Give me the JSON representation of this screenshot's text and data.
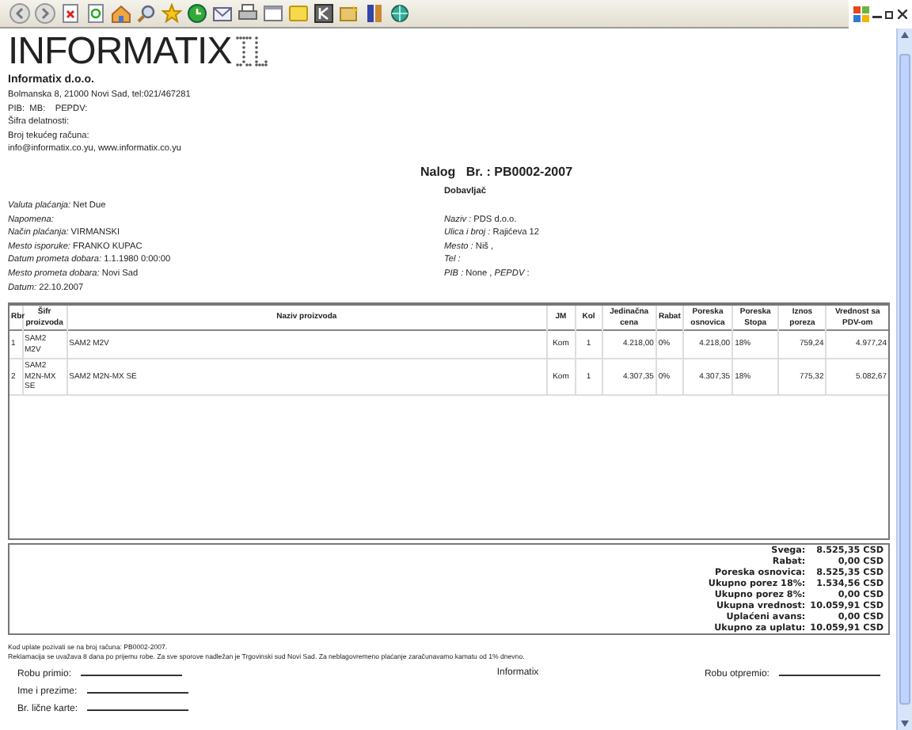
{
  "company": {
    "logo": "INFORMATIX",
    "name": "Informatix d.o.o.",
    "lines": [
      "Bolmanska 8, 21000 Novi Sad, tel:021/467281",
      "PIB:  MB:    PEPDV:",
      "Šifra delatnosti:",
      "Broj tekućeg računa:",
      "info@informatix.co.yu, www.informatix.co.yu"
    ]
  },
  "document_title": "Nalog   Br. : PB0002-2007",
  "payment_info": [
    {
      "label": "Valuta plaćanja:",
      "value": "Net Due"
    },
    {
      "label": "Napomena:"
    },
    {
      "label": "Način plaćanja:",
      "value": "VIRMANSKI"
    },
    {
      "label": "Mesto isporuke:",
      "value": "FRANKO KUPAC"
    },
    {
      "label": "Datum prometa dobara:",
      "value": "1.1.1980 0:00:00"
    },
    {
      "label": "Mesto prometa dobara:",
      "value": "Novi Sad"
    },
    {
      "label": "Datum:",
      "value": "22.10.2007"
    }
  ],
  "supplier": {
    "heading": "Dobavljač",
    "lines": [
      {
        "label": "Naziv :",
        "value": "PDS d.o.o."
      },
      {
        "label": "Ulica i broj :",
        "value": "Rajićeva 12"
      },
      {
        "label": "Mesto :",
        "value": "Niš ,"
      },
      {
        "label": "Tel :"
      },
      {
        "label": "PIB :",
        "value": "None , *PEPDV* :"
      }
    ]
  },
  "table": {
    "columns": [
      "Rbr",
      "Šifr proizvoda",
      "Naziv proizvoda",
      "JM",
      "Kol",
      "Jedinačna cena",
      "Rabat",
      "Poreska osnovica",
      "Poreska Stopa",
      "Iznos poreza",
      "Vrednost sa PDV-om"
    ],
    "rows": [
      [
        "1",
        "SAM2 M2V",
        "SAM2 M2V",
        "Kom",
        "1",
        "4.218,00",
        "0%",
        "4.218,00",
        "18%",
        "759,24",
        "4.977,24"
      ],
      [
        "2",
        "SAM2 M2N-MX SE",
        "SAM2 M2N-MX SE",
        "Kom",
        "1",
        "4.307,35",
        "0%",
        "4.307,35",
        "18%",
        "775,32",
        "5.082,67"
      ]
    ]
  },
  "totals": [
    {
      "label": "Svega:",
      "value": "8.525,35 CSD"
    },
    {
      "label": "Rabat:",
      "value": "0,00 CSD"
    },
    {
      "label": "Poreska osnovica:",
      "value": "8.525,35 CSD"
    },
    {
      "label": "Ukupno porez 18%:",
      "value": "1.534,56 CSD"
    },
    {
      "label": "Ukupno porez 8%:",
      "value": "0,00 CSD"
    },
    {
      "label": "Ukupna vrednost:",
      "value": "10.059,91 CSD"
    },
    {
      "label": "Uplaćeni avans:",
      "value": "0,00 CSD"
    },
    {
      "label": "Ukupno za uplatu:",
      "value": "10.059,91 CSD"
    }
  ],
  "notes": [
    "Kod uplate pozivati se na broj računa: PB0002-2007.",
    "Reklamacija se uvažava 8 dana po prijemu robe. Za sve sporove nadležan je Trgovinski sud Novi Sad. Za neblagovremeno plaćanje zaračunavamo kamatu od 1% dnevno."
  ],
  "signatures": {
    "left": [
      "Robu primio:",
      "Ime i prezime:",
      "Br. lične karte:"
    ],
    "center": "Informatix",
    "right": "Robu otpremio:"
  }
}
